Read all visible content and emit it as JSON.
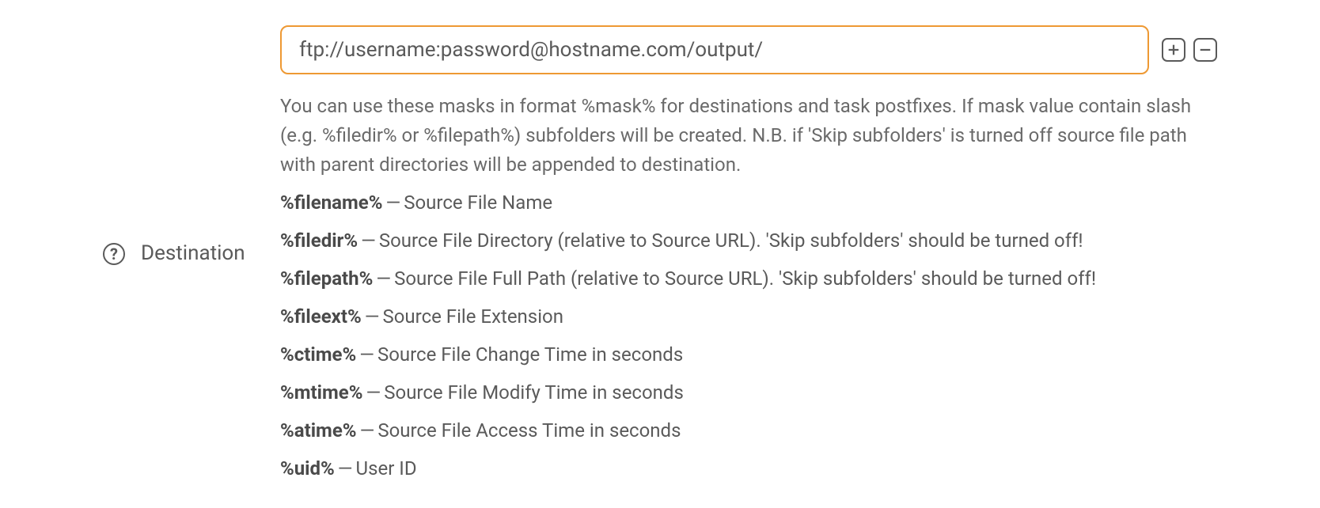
{
  "field": {
    "label": "Destination",
    "input_value": "ftp://username:password@hostname.com/output/",
    "help_text": "You can use these masks in format %mask% for destinations and task postfixes. If mask value contain slash (e.g. %filedir% or %filepath%) subfolders will be created. N.B. if 'Skip subfolders' is turned off source file path with parent directories will be appended to destination."
  },
  "masks": [
    {
      "name": "%filename%",
      "desc": "Source File Name"
    },
    {
      "name": "%filedir%",
      "desc": "Source File Directory (relative to Source URL). 'Skip subfolders' should be turned off!"
    },
    {
      "name": "%filepath%",
      "desc": "Source File Full Path (relative to Source URL). 'Skip subfolders' should be turned off!"
    },
    {
      "name": "%fileext%",
      "desc": "Source File Extension"
    },
    {
      "name": "%ctime%",
      "desc": "Source File Change Time in seconds"
    },
    {
      "name": "%mtime%",
      "desc": "Source File Modify Time in seconds"
    },
    {
      "name": "%atime%",
      "desc": "Source File Access Time in seconds"
    },
    {
      "name": "%uid%",
      "desc": "User ID"
    }
  ],
  "icons": {
    "help": "?",
    "add": "plus",
    "remove": "minus"
  }
}
